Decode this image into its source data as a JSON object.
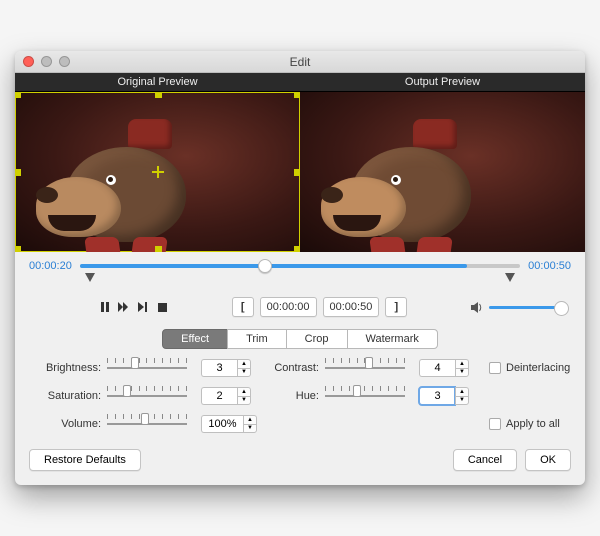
{
  "window": {
    "title": "Edit"
  },
  "previews": {
    "original_label": "Original Preview",
    "output_label": "Output Preview"
  },
  "timeline": {
    "start_time": "00:00:20",
    "end_time": "00:00:50",
    "position_pct": 42,
    "fill_pct": 88
  },
  "transport": {
    "range_start": "00:00:00",
    "range_end": "00:00:50",
    "bracket_open": "[",
    "bracket_close": "]"
  },
  "tabs": {
    "items": [
      "Effect",
      "Trim",
      "Crop",
      "Watermark"
    ],
    "active_index": 0
  },
  "fields": {
    "brightness": {
      "label": "Brightness:",
      "value": "3",
      "thumb_pct": 35
    },
    "contrast": {
      "label": "Contrast:",
      "value": "4",
      "thumb_pct": 55
    },
    "saturation": {
      "label": "Saturation:",
      "value": "2",
      "thumb_pct": 25
    },
    "hue": {
      "label": "Hue:",
      "value": "3",
      "thumb_pct": 40
    },
    "volume": {
      "label": "Volume:",
      "value": "100%",
      "thumb_pct": 48
    }
  },
  "checks": {
    "deinterlacing": "Deinterlacing",
    "apply_all": "Apply to all"
  },
  "footer": {
    "restore": "Restore Defaults",
    "cancel": "Cancel",
    "ok": "OK"
  }
}
